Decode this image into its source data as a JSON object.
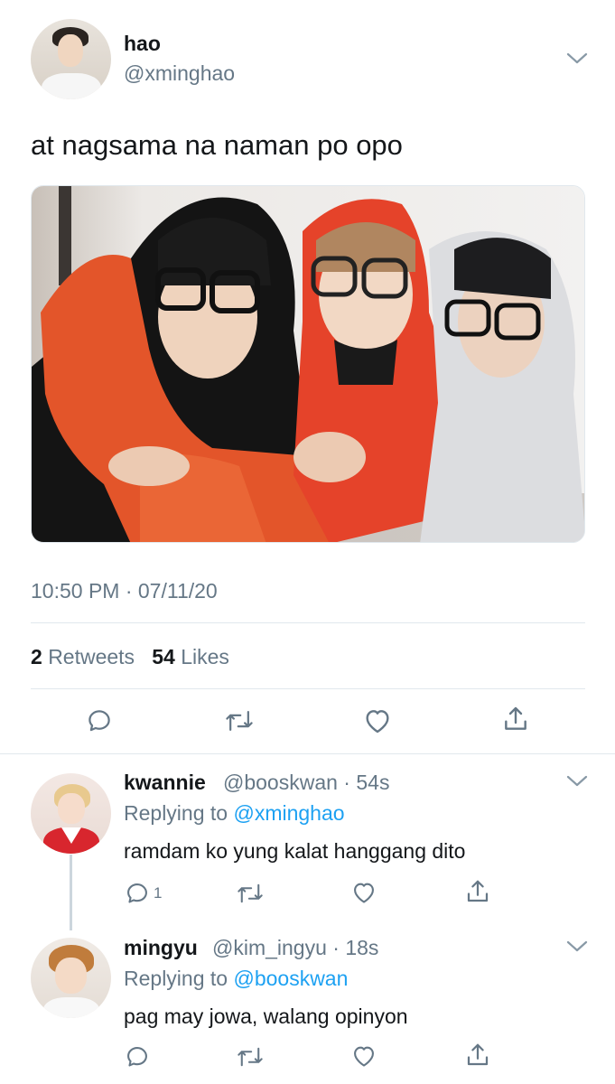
{
  "tweet": {
    "author_name": "hao",
    "author_handle": "@xminghao",
    "text": "at nagsama na naman po opo",
    "timestamp": "10:50 PM · 07/11/20",
    "retweets_count": "2",
    "retweets_label": "Retweets",
    "likes_count": "54",
    "likes_label": "Likes"
  },
  "replies": [
    {
      "name": "kwannie",
      "meta": "@booskwan · 54s",
      "replying_prefix": "Replying to",
      "replying_to": "@xminghao",
      "text": "ramdam ko yung kalat hanggang dito",
      "reply_count": "1"
    },
    {
      "name": "mingyu",
      "meta": "@kim_ingyu · 18s",
      "replying_prefix": "Replying to",
      "replying_to": "@booskwan",
      "text": "pag may jowa, walang opinyon",
      "reply_count": ""
    }
  ],
  "icons": [
    "reply-icon",
    "retweet-icon",
    "like-icon",
    "share-icon",
    "chevron-down-icon"
  ],
  "colors": {
    "text": "#14171a",
    "secondary": "#657786",
    "link": "#1da1f2",
    "divider": "#e1e8ed",
    "thread_line": "#ccd6dd"
  }
}
